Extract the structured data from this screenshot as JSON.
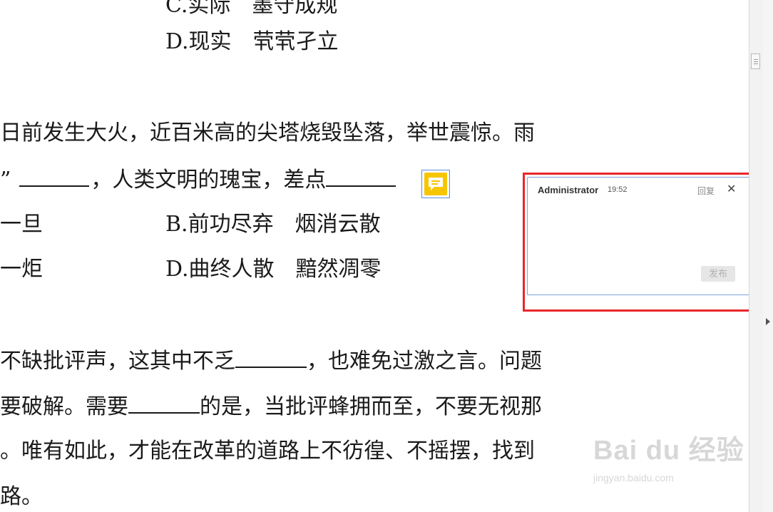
{
  "document": {
    "cut_line": "C.实际　墨守成规",
    "lines": [
      {
        "segments": [
          "D.现实　茕茕孑立"
        ]
      },
      {
        "segments": [
          "日前发生大火，近百米高的尖塔烧毁坠落，举世震惊。雨"
        ]
      },
      {
        "segments": [
          "”",
          "，人类文明的瑰宝，差点"
        ]
      },
      {
        "segments": [
          "一旦",
          "B.前功尽弃　烟消云散"
        ]
      },
      {
        "segments": [
          "一炬",
          "D.曲终人散　黯然凋零"
        ]
      },
      {
        "segments": [
          "不缺批评声，这其中不乏",
          "，也难免过激之言。问题"
        ]
      },
      {
        "segments": [
          "要破解。需要",
          "的是，当批评蜂拥而至，不要无视那"
        ]
      },
      {
        "segments": [
          "。唯有如此，才能在改革的道路上不彷徨、不摇摆，找到"
        ]
      },
      {
        "segments": [
          "路。"
        ]
      }
    ]
  },
  "comment": {
    "author": "Administrator",
    "time": "19:52",
    "reply_label": "回复",
    "close_symbol": "✕",
    "publish_label": "发布"
  },
  "watermark": {
    "brand": "Bai du 经验",
    "url": "jingyan.baidu.com"
  },
  "colors": {
    "highlight_frame": "#e8262b",
    "comment_border": "#7aa3d8",
    "marker_fill": "#f7c600"
  }
}
